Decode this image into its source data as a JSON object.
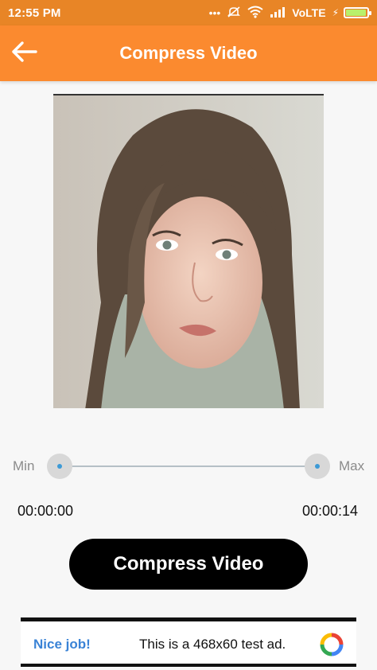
{
  "status_bar": {
    "time": "12:55 PM",
    "dots": "•••",
    "network": "VoLTE",
    "icons": [
      "mute-icon",
      "wifi-icon",
      "signal-icon",
      "charging-icon",
      "battery-icon"
    ],
    "battery_level": 0.88
  },
  "app_bar": {
    "title": "Compress Video",
    "back_icon": "arrow-left-icon",
    "color": "#fb8a2f"
  },
  "video": {
    "preview": "video-thumbnail"
  },
  "range": {
    "min_label": "Min",
    "max_label": "Max",
    "start_time": "00:00:00",
    "end_time": "00:00:14",
    "start_fraction": 0,
    "end_fraction": 1
  },
  "actions": {
    "compress_label": "Compress Video"
  },
  "ad": {
    "headline": "Nice job!",
    "body": "This is a 468x60 test ad."
  }
}
